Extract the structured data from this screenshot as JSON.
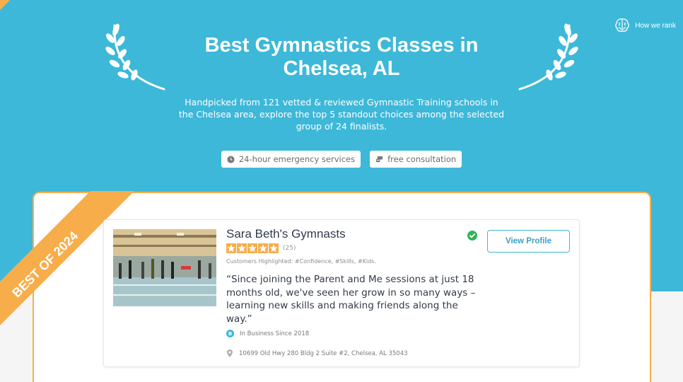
{
  "header": {
    "title": "Best Gymnastics Classes in Chelsea, AL",
    "subtitle": "Handpicked from 121 vetted & reviewed Gymnastic Training schools in the Chelsea area, explore the top 5 standout choices among the selected group of 24 finalists.",
    "how_we_rank_label": "How we rank",
    "chips": [
      {
        "label": "24-hour emergency services",
        "icon": "clock-icon"
      },
      {
        "label": "free consultation",
        "icon": "chat-icon"
      }
    ]
  },
  "badge": {
    "label": "BEST OF 2024"
  },
  "listing": {
    "name": "Sara Beth's Gymnasts",
    "rating": 5,
    "rating_count": "(25)",
    "highlighted": "Customers Highlighted: #Confidence, #Skills, #Kids.",
    "quote": "“Since joining the Parent and Me sessions at just 18 months old, we've seen her grow in so many ways – learning new skills and making friends along the way.”",
    "in_business": "In Business Since 2018",
    "address": "10699 Old Hwy 280 Bldg 2 Suite #2, Chelsea, AL 35043",
    "view_profile_label": "View Profile",
    "verified": true
  },
  "colors": {
    "hero_blue": "#3db8d9",
    "ribbon_orange": "#f8ad4b",
    "star": "#f8ad4b",
    "verified_green": "#2fb45a",
    "button_text": "#3a9fc4"
  }
}
